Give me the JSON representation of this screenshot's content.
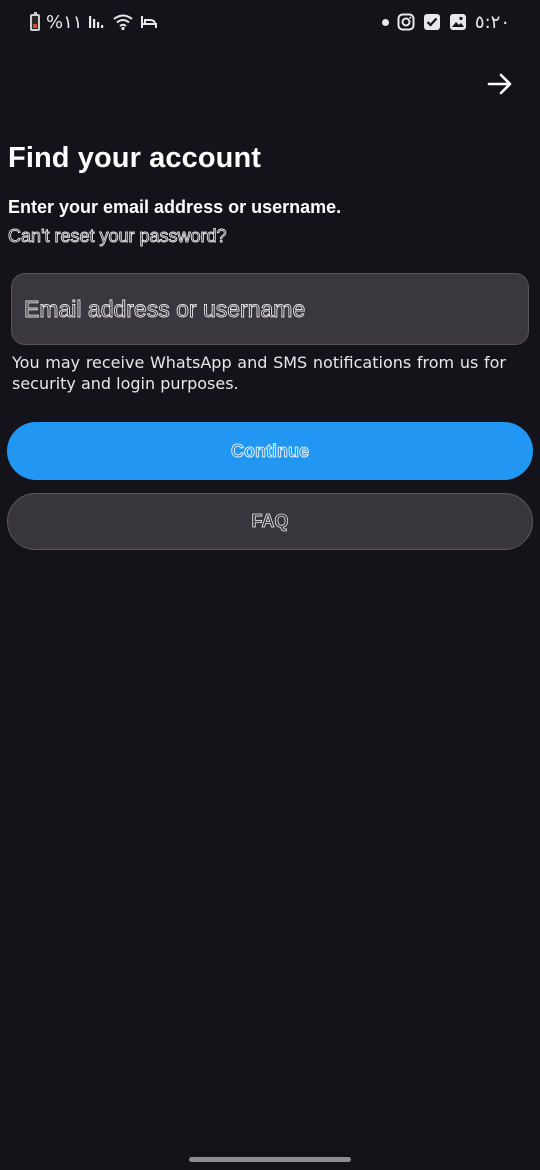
{
  "status_bar": {
    "battery_text": "%١١",
    "time": "٥:٢٠",
    "icons_left": [
      "battery-icon",
      "signal-icon",
      "wifi-icon",
      "sleep-mode-icon"
    ],
    "icons_right": [
      "notification-dot-icon",
      "instagram-icon",
      "checkbox-icon",
      "gallery-icon"
    ]
  },
  "header": {
    "next_icon": "arrow-right-icon"
  },
  "main": {
    "title": "Find your account",
    "subtitle": "Enter your email address or username.",
    "cant_reset_link": "Can't reset your password?",
    "input_placeholder": "Email address or username",
    "input_value": "",
    "notice": "You may receive WhatsApp and SMS notifications from us for security and login purposes.",
    "continue_label": "Continue",
    "faq_label": "FAQ"
  },
  "colors": {
    "background": "#15131a",
    "primary_button": "#2196f3",
    "secondary_button": "#38363c"
  }
}
